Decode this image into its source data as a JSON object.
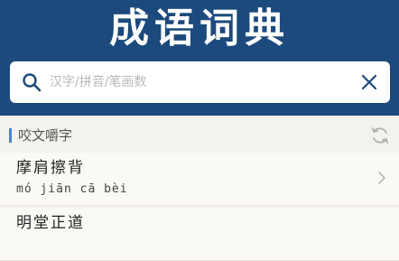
{
  "app": {
    "title": "成语词典"
  },
  "search": {
    "placeholder": "汉字/拼音/笔画数",
    "value": ""
  },
  "section": {
    "title": "咬文嚼字"
  },
  "idioms": [
    {
      "name": "摩肩擦背",
      "pinyin": "mó jiān cā bèi"
    },
    {
      "name": "明堂正道",
      "pinyin": ""
    }
  ],
  "icons": {
    "search": "search-icon",
    "clear": "close-icon",
    "refresh": "refresh-icon",
    "chevron": "chevron-right-icon"
  },
  "colors": {
    "header_bg": "#1c4a7c",
    "accent": "#4a86c8",
    "page_bg": "#f4f2ee"
  }
}
